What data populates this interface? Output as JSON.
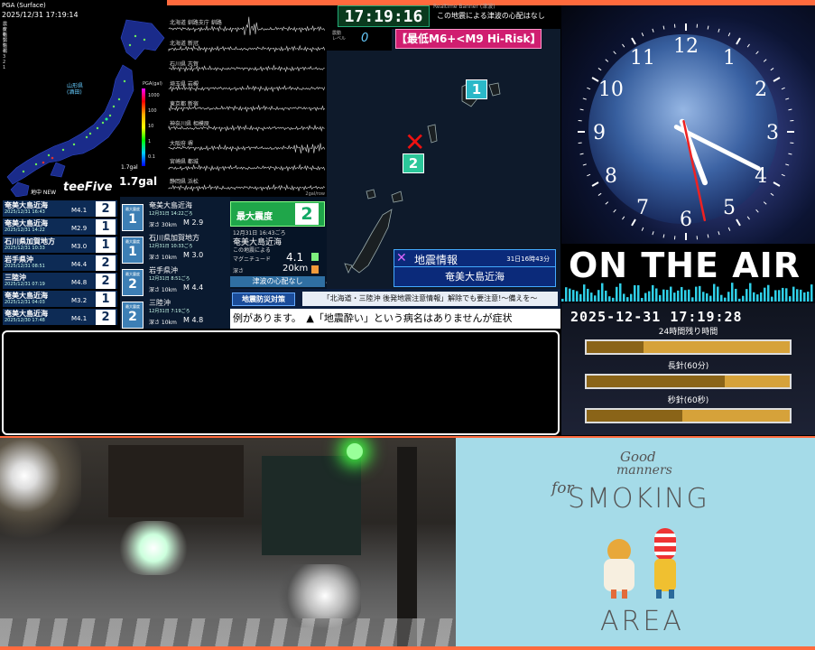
{
  "map": {
    "header": "PGA (Surface)",
    "timestamp": "2025/12/31 17:19:14",
    "pga_value": "1.7gal",
    "pga_small": "1.7gal",
    "scale_title": "PGA(gal)",
    "scale_ticks": [
      "1000",
      "100",
      "10",
      "1",
      "0.1"
    ],
    "region_tag": "山形県\n(酒田)",
    "brand": "teeFive",
    "list_header": "地中 NEW",
    "legend": [
      "震度7",
      "6強",
      "6弱",
      "5強",
      "5弱",
      "4",
      "3",
      "2",
      "1"
    ]
  },
  "waveform": {
    "stations": [
      "北海道 釧路支庁 釧路",
      "北海道 新冠",
      "石川県 志賀",
      "埼玉県 岩槻",
      "東京都 新宿",
      "神奈川県 相模原",
      "大阪府 堺",
      "宮崎県 都城",
      "静岡県 浜松"
    ],
    "unit": "2gal/row"
  },
  "eq_list": [
    {
      "name": "奄美大島近海",
      "date": "2025/12/31 16:43",
      "mag": "M4.1",
      "shindo": "2"
    },
    {
      "name": "奄美大島近海",
      "date": "2025/12/31 14:22",
      "mag": "M2.9",
      "shindo": "1"
    },
    {
      "name": "石川県加賀地方",
      "date": "2025/12/31 10:33",
      "mag": "M3.0",
      "shindo": "1"
    },
    {
      "name": "岩手県沖",
      "date": "2025/12/31 08:51",
      "mag": "M4.4",
      "shindo": "2"
    },
    {
      "name": "三陸沖",
      "date": "2025/12/31 07:19",
      "mag": "M4.8",
      "shindo": "2"
    },
    {
      "name": "奄美大島近海",
      "date": "2025/12/31 04:03",
      "mag": "M3.2",
      "shindo": "1"
    },
    {
      "name": "奄美大島近海",
      "date": "2025/12/30 17:48",
      "mag": "M4.1",
      "shindo": "2"
    }
  ],
  "details": [
    {
      "name": "奄美大島近海",
      "date": "12月31日 14:22ごろ",
      "depth": "深さ 30km",
      "mag": "M 2.9",
      "shindo": "1",
      "label": "最大震度"
    },
    {
      "name": "石川県加賀地方",
      "date": "12月31日 10:33ごろ",
      "depth": "深さ 10km",
      "mag": "M 3.0",
      "shindo": "1",
      "label": "最大震度"
    },
    {
      "name": "岩手県沖",
      "date": "12月31日 8:51ごろ",
      "depth": "深さ 10km",
      "mag": "M 4.4",
      "shindo": "2",
      "label": "最大震度"
    },
    {
      "name": "三陸沖",
      "date": "12月31日 7:19ごろ",
      "depth": "深さ 10km",
      "mag": "M 4.8",
      "shindo": "2",
      "label": "最大震度"
    }
  ],
  "max": {
    "label": "最大震度",
    "value": "2",
    "time": "12月31日 16:43ごろ",
    "region": "奄美大島近海",
    "note": "この地震による",
    "mag_label": "マグニチュード",
    "mag": "4.1",
    "depth_label": "深さ",
    "depth": "20km",
    "tsunami": "津波の心配なし",
    "brand": "teeFive"
  },
  "center": {
    "time": "17:19:16",
    "tsunami_msg": "この地震による津波の心配はなし",
    "top_strip": "Realtime Banner (津波)",
    "level_label": "震動\nレベル",
    "level_value": "0",
    "risk": "【最低M6+<M9 Hi-Risk】",
    "marker1": "1",
    "marker2": "2",
    "info_title": "地震情報",
    "info_time": "31日16時43分",
    "info_region": "奄美大島近海"
  },
  "ticker": {
    "tag": "地震防災対策",
    "headline": "「北海道・三陸沖 後発地震注意情報」解除でも要注意!～備えを～",
    "scroll": "例があります。　▲「地震酔い」という病名はありませんが症状"
  },
  "clock": {
    "numbers": [
      "12",
      "1",
      "2",
      "3",
      "4",
      "5",
      "6",
      "7",
      "8",
      "9",
      "10",
      "11"
    ],
    "hour": 17,
    "minute": 19,
    "second": 28,
    "on_air": "ON THE AIR",
    "datetime": "2025-12-31 17:19:28",
    "bars": [
      {
        "label": "24時間残り時間",
        "progress": 0.28
      },
      {
        "label": "長針(60分)",
        "progress": 0.68
      },
      {
        "label": "秒針(60秒)",
        "progress": 0.47
      }
    ]
  },
  "poster": {
    "line1": "Good",
    "line2": "manners",
    "line3": "for",
    "line4": "SMOKING",
    "line5": "AREA"
  },
  "colors": {
    "accent": "#ff6a3d",
    "panel_blue": "#0d2b55",
    "cyan": "#2fd0e8",
    "green": "#1fa64a",
    "pink": "#e0247a"
  }
}
